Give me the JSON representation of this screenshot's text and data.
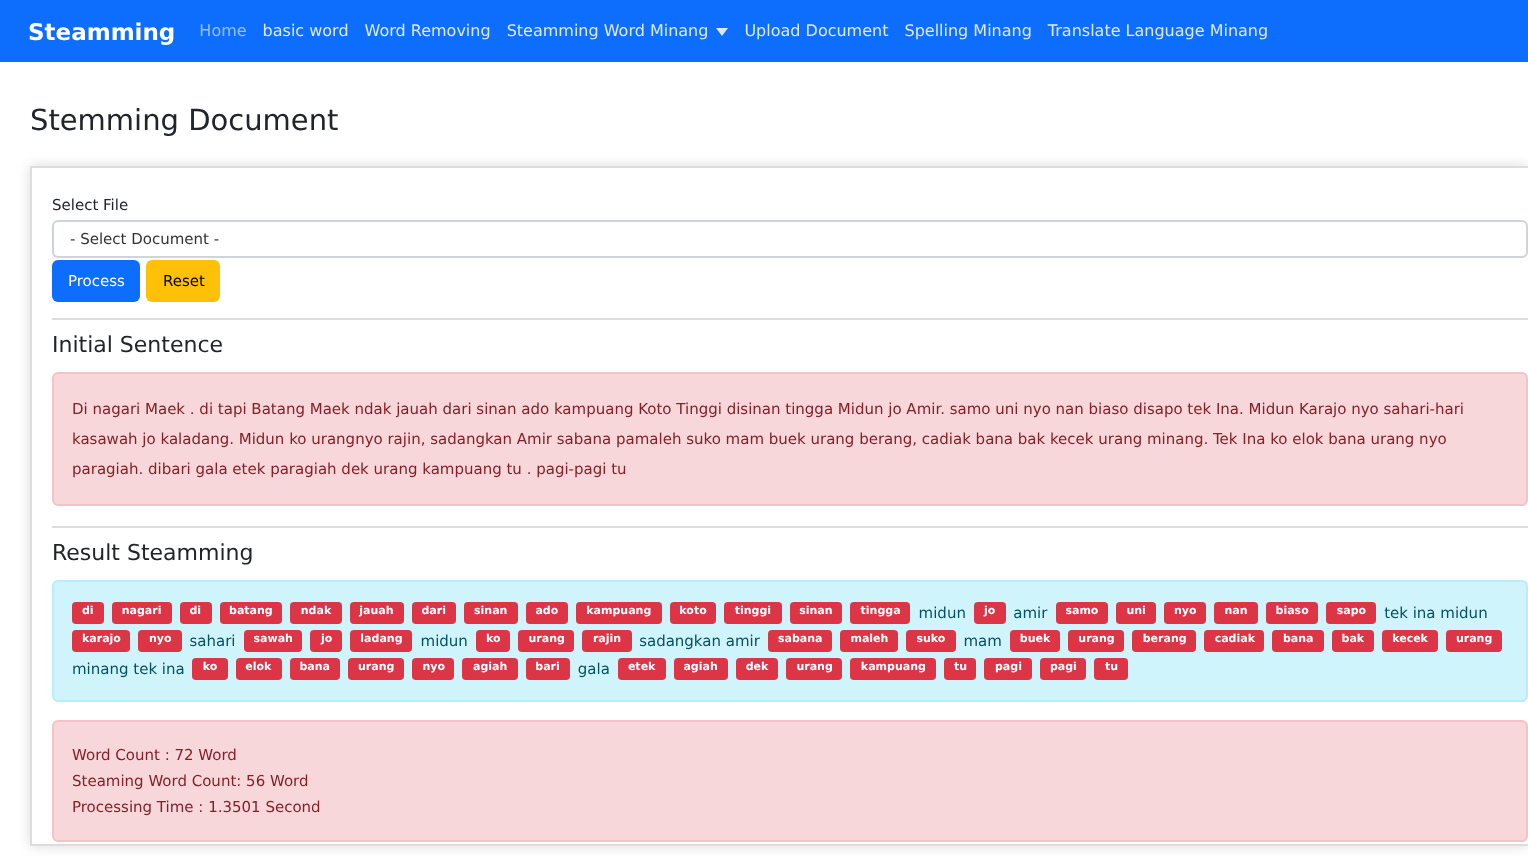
{
  "navbar": {
    "brand": "Steamming",
    "links": [
      {
        "label": "Home",
        "selected": true,
        "dropdown": false
      },
      {
        "label": "basic word",
        "selected": false,
        "dropdown": false
      },
      {
        "label": "Word Removing",
        "selected": false,
        "dropdown": false
      },
      {
        "label": "Steamming Word Minang",
        "selected": false,
        "dropdown": true
      },
      {
        "label": "Upload Document",
        "selected": false,
        "dropdown": false
      },
      {
        "label": "Spelling Minang",
        "selected": false,
        "dropdown": false
      },
      {
        "label": "Translate Language Minang",
        "selected": false,
        "dropdown": false
      }
    ]
  },
  "page_title": "Stemming Document",
  "form": {
    "label": "Select File",
    "select": {
      "value": "- Select Document -"
    },
    "buttons": [
      {
        "label": "Process",
        "kind": "primary"
      },
      {
        "label": "Reset",
        "kind": "warning"
      }
    ]
  },
  "initial": {
    "heading": "Initial Sentence",
    "text": "Di nagari Maek . di tapi Batang Maek ndak jauah dari sinan ado kampuang Koto Tinggi disinan tingga Midun jo Amir. samo uni nyo nan biaso disapo tek Ina. Midun Karajo nyo sahari-hari kasawah jo kaladang. Midun ko urangnyo rajin, sadangkan Amir sabana pamaleh suko mam buek urang berang, cadiak bana bak kecek urang minang. Tek Ina ko elok bana urang nyo paragiah. dibari gala etek paragiah dek urang kampuang tu . pagi-pagi tu"
  },
  "result": {
    "heading": "Result Steamming",
    "tokens": [
      {
        "text": "di",
        "kind": "stem"
      },
      {
        "text": "nagari",
        "kind": "stem"
      },
      {
        "text": "di",
        "kind": "stem"
      },
      {
        "text": "batang",
        "kind": "stem"
      },
      {
        "text": "ndak",
        "kind": "stem"
      },
      {
        "text": "jauah",
        "kind": "stem"
      },
      {
        "text": "dari",
        "kind": "stem"
      },
      {
        "text": "sinan",
        "kind": "stem"
      },
      {
        "text": "ado",
        "kind": "stem"
      },
      {
        "text": "kampuang",
        "kind": "stem"
      },
      {
        "text": "koto",
        "kind": "stem"
      },
      {
        "text": "tinggi",
        "kind": "stem"
      },
      {
        "text": "sinan",
        "kind": "stem"
      },
      {
        "text": "tingga",
        "kind": "stem"
      },
      {
        "text": "midun",
        "kind": "word"
      },
      {
        "text": "jo",
        "kind": "stem"
      },
      {
        "text": "amir",
        "kind": "word"
      },
      {
        "text": "samo",
        "kind": "stem"
      },
      {
        "text": "uni",
        "kind": "stem"
      },
      {
        "text": "nyo",
        "kind": "stem"
      },
      {
        "text": "nan",
        "kind": "stem"
      },
      {
        "text": "biaso",
        "kind": "stem"
      },
      {
        "text": "sapo",
        "kind": "stem"
      },
      {
        "text": "tek ina midun",
        "kind": "word"
      },
      {
        "text": "karajo",
        "kind": "stem"
      },
      {
        "text": "nyo",
        "kind": "stem"
      },
      {
        "text": "sahari",
        "kind": "word"
      },
      {
        "text": "sawah",
        "kind": "stem"
      },
      {
        "text": "jo",
        "kind": "stem"
      },
      {
        "text": "ladang",
        "kind": "stem"
      },
      {
        "text": "midun",
        "kind": "word"
      },
      {
        "text": "ko",
        "kind": "stem"
      },
      {
        "text": "urang",
        "kind": "stem"
      },
      {
        "text": "rajin",
        "kind": "stem"
      },
      {
        "text": "sadangkan amir",
        "kind": "word"
      },
      {
        "text": "sabana",
        "kind": "stem"
      },
      {
        "text": "maleh",
        "kind": "stem"
      },
      {
        "text": "suko",
        "kind": "stem"
      },
      {
        "text": "mam",
        "kind": "word"
      },
      {
        "text": "buek",
        "kind": "stem"
      },
      {
        "text": "urang",
        "kind": "stem"
      },
      {
        "text": "berang",
        "kind": "stem"
      },
      {
        "text": "cadiak",
        "kind": "stem"
      },
      {
        "text": "bana",
        "kind": "stem"
      },
      {
        "text": "bak",
        "kind": "stem"
      },
      {
        "text": "kecek",
        "kind": "stem"
      },
      {
        "text": "urang",
        "kind": "stem"
      },
      {
        "text": "minang tek ina",
        "kind": "word"
      },
      {
        "text": "ko",
        "kind": "stem"
      },
      {
        "text": "elok",
        "kind": "stem"
      },
      {
        "text": "bana",
        "kind": "stem"
      },
      {
        "text": "urang",
        "kind": "stem"
      },
      {
        "text": "nyo",
        "kind": "stem"
      },
      {
        "text": "agiah",
        "kind": "stem"
      },
      {
        "text": "bari",
        "kind": "stem"
      },
      {
        "text": "gala",
        "kind": "word"
      },
      {
        "text": "etek",
        "kind": "stem"
      },
      {
        "text": "agiah",
        "kind": "stem"
      },
      {
        "text": "dek",
        "kind": "stem"
      },
      {
        "text": "urang",
        "kind": "stem"
      },
      {
        "text": "kampuang",
        "kind": "stem"
      },
      {
        "text": "tu",
        "kind": "stem"
      },
      {
        "text": "pagi",
        "kind": "stem"
      },
      {
        "text": "pagi",
        "kind": "stem"
      },
      {
        "text": "tu",
        "kind": "stem"
      }
    ]
  },
  "stats": [
    "Word Count : 72 Word",
    "Steaming Word Count: 56 Word",
    "Processing Time : 1.3501 Second"
  ]
}
